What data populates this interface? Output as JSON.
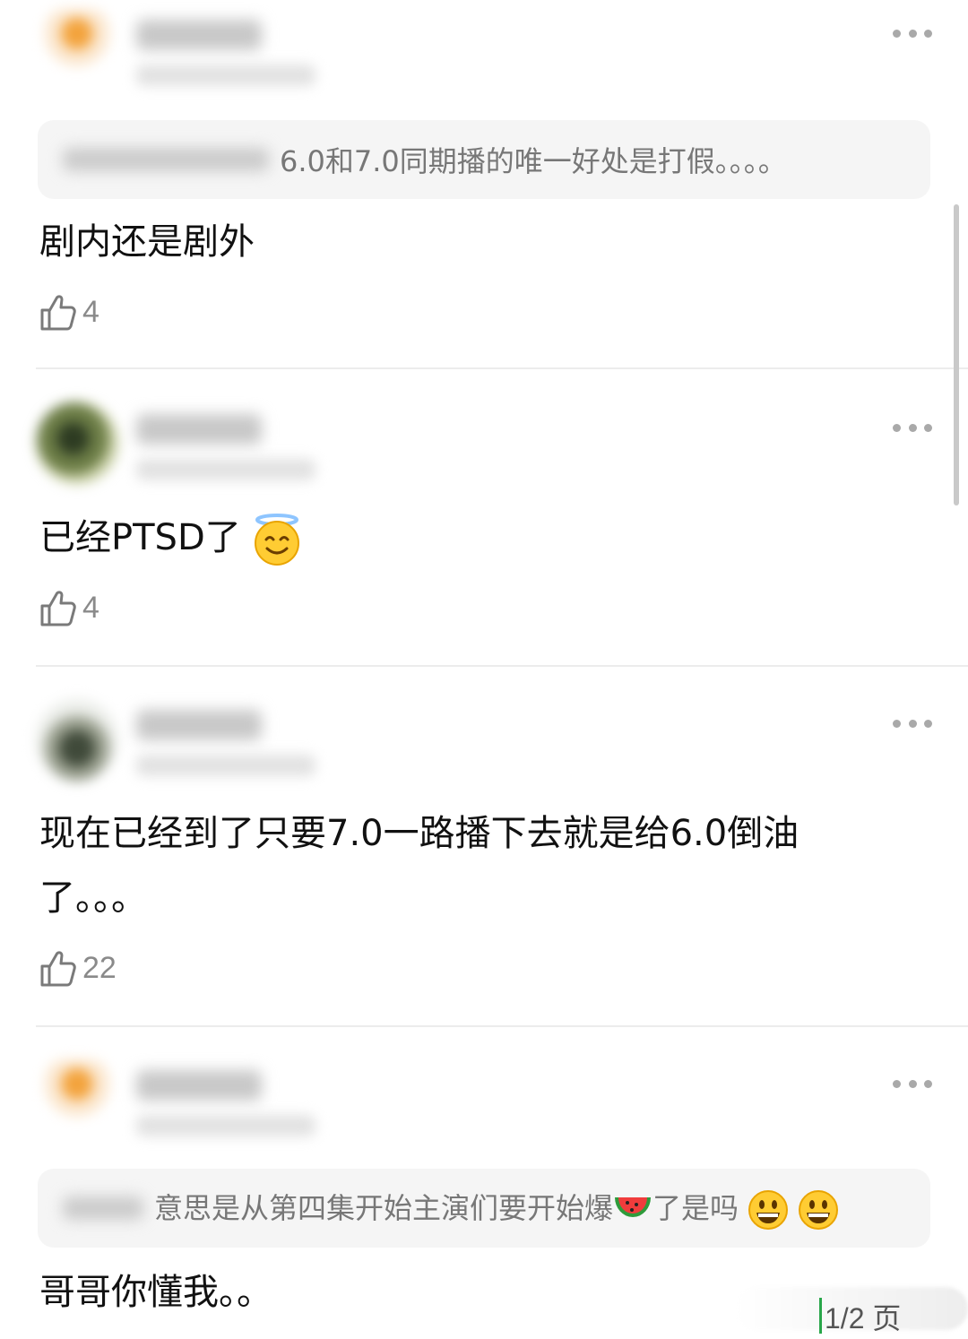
{
  "comments": [
    {
      "quote_text": "6.0和7.0同期播的唯一好处是打假。。。。",
      "body": "剧内还是剧外",
      "likes": "4"
    },
    {
      "body": "已经PTSD了",
      "body_emoji": "halo-smile-emoji",
      "likes": "4"
    },
    {
      "body_line1": "现在已经到了只要7.0一路播下去就是给6.0倒油",
      "body_line2": "了。。。",
      "likes": "22"
    },
    {
      "quote_text": "意思是从第四集开始主演们要开始爆",
      "quote_text_after": "了是吗",
      "quote_emojis": [
        "watermelon-emoji",
        "grin-emoji",
        "grin-emoji"
      ],
      "body": "哥哥你懂我。。"
    }
  ],
  "icons": {
    "more": "more-horizontal-icon",
    "like": "thumbs-up-icon"
  },
  "page_indicator": "1/2 页"
}
